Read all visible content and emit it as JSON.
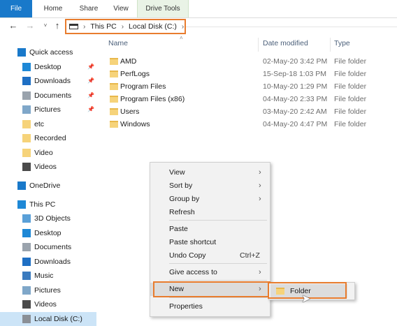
{
  "ribbon": {
    "tabs": [
      "File",
      "Home",
      "Share",
      "View",
      "Drive Tools"
    ]
  },
  "nav": {
    "back_icon": "←",
    "forward_icon": "→",
    "history_icon": "˅",
    "up_icon": "↑",
    "breadcrumb": [
      "This PC",
      "Local Disk (C:)"
    ],
    "separator": "›"
  },
  "sidebar": {
    "items": [
      {
        "label": "Quick access",
        "icon": "star-icon",
        "pinned": false
      },
      {
        "label": "Desktop",
        "icon": "desktop-icon",
        "pinned": true
      },
      {
        "label": "Downloads",
        "icon": "download-icon",
        "pinned": true
      },
      {
        "label": "Documents",
        "icon": "documents-icon",
        "pinned": true
      },
      {
        "label": "Pictures",
        "icon": "pictures-icon",
        "pinned": true
      },
      {
        "label": "etc",
        "icon": "folder-icon",
        "pinned": false
      },
      {
        "label": "Recorded",
        "icon": "folder-icon",
        "pinned": false
      },
      {
        "label": "Video",
        "icon": "folder-icon",
        "pinned": false
      },
      {
        "label": "Videos",
        "icon": "videos-icon",
        "pinned": false
      },
      {
        "label": "OneDrive",
        "icon": "cloud-icon",
        "pinned": false
      },
      {
        "label": "This PC",
        "icon": "pc-icon",
        "pinned": false
      },
      {
        "label": "3D Objects",
        "icon": "cube-icon",
        "pinned": false
      },
      {
        "label": "Desktop",
        "icon": "desktop-icon",
        "pinned": false
      },
      {
        "label": "Documents",
        "icon": "documents-icon",
        "pinned": false
      },
      {
        "label": "Downloads",
        "icon": "download-icon",
        "pinned": false
      },
      {
        "label": "Music",
        "icon": "music-icon",
        "pinned": false
      },
      {
        "label": "Pictures",
        "icon": "pictures-icon",
        "pinned": false
      },
      {
        "label": "Videos",
        "icon": "videos-icon",
        "pinned": false
      },
      {
        "label": "Local Disk (C:)",
        "icon": "drive-icon",
        "pinned": false
      }
    ]
  },
  "columns": {
    "name": "Name",
    "date": "Date modified",
    "type": "Type"
  },
  "files": [
    {
      "name": "AMD",
      "date": "02-May-20 3:42 PM",
      "type": "File folder"
    },
    {
      "name": "PerfLogs",
      "date": "15-Sep-18 1:03 PM",
      "type": "File folder"
    },
    {
      "name": "Program Files",
      "date": "10-May-20 1:29 PM",
      "type": "File folder"
    },
    {
      "name": "Program Files (x86)",
      "date": "04-May-20 2:33 PM",
      "type": "File folder"
    },
    {
      "name": "Users",
      "date": "03-May-20 2:42 AM",
      "type": "File folder"
    },
    {
      "name": "Windows",
      "date": "04-May-20 4:47 PM",
      "type": "File folder"
    }
  ],
  "context_menu": {
    "items": [
      {
        "label": "View",
        "shortcut": "",
        "submenu": true
      },
      {
        "label": "Sort by",
        "shortcut": "",
        "submenu": true
      },
      {
        "label": "Group by",
        "shortcut": "",
        "submenu": true
      },
      {
        "label": "Refresh",
        "shortcut": "",
        "submenu": false
      },
      {
        "label": "Paste",
        "shortcut": "",
        "submenu": false
      },
      {
        "label": "Paste shortcut",
        "shortcut": "",
        "submenu": false
      },
      {
        "label": "Undo Copy",
        "shortcut": "Ctrl+Z",
        "submenu": false
      },
      {
        "label": "Give access to",
        "shortcut": "",
        "submenu": true
      },
      {
        "label": "New",
        "shortcut": "",
        "submenu": true
      },
      {
        "label": "Properties",
        "shortcut": "",
        "submenu": false
      }
    ],
    "submenu_arrow": "›"
  },
  "new_submenu": {
    "items": [
      {
        "label": "Folder",
        "icon": "folder-icon"
      }
    ]
  },
  "colors": {
    "accent": "#1979ca",
    "highlight": "#e87c2e",
    "folder": "#f6d37a",
    "selection": "#cce4f7"
  }
}
